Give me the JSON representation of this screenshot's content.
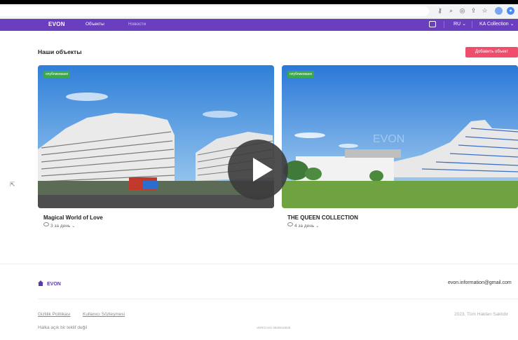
{
  "nav": {
    "logo": "EVON",
    "links": [
      "Объекты",
      "Новости"
    ],
    "lang": "RU",
    "user": "KA Collection"
  },
  "main": {
    "heading": "Наши объекты",
    "add_button": "Добавить объект",
    "watermark": "EVON",
    "cards": [
      {
        "badge": "опубликовано",
        "title": "Magical World of Love",
        "views": "3 за день"
      },
      {
        "badge": "опубликовано",
        "title": "THE QUEEN COLLECTION",
        "views": "4 за день"
      }
    ]
  },
  "footer": {
    "logo": "EVON",
    "email": "evon.information@gmail.com",
    "links": [
      "Gizlilik Politikası",
      "Kullanıcı Sözleşmesi"
    ],
    "copyright": "2023. Tüm Hakları Saklıdır",
    "offer": "Halka açık bir teklif değil",
    "vergi": "VERGI NO 3830916835"
  },
  "colors": {
    "nav": "#6a3fbf",
    "accent_button": "#ee4d6b",
    "badge": "#39a94a"
  },
  "icons": [
    "key-icon",
    "zoom-icon",
    "eye-off-icon",
    "share-icon",
    "star-icon",
    "extension-icon",
    "profile-icon",
    "chat-icon",
    "home-icon",
    "eye-icon",
    "play-icon",
    "cursor-icon"
  ]
}
